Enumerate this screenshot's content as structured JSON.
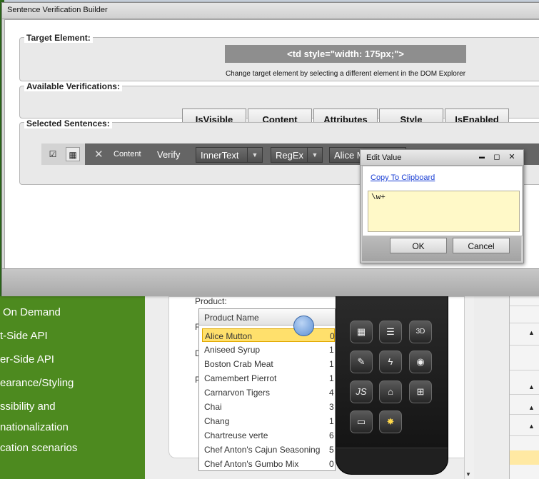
{
  "background": {
    "nav_items": [
      "On Demand",
      "t-Side API",
      "er-Side API",
      "earance/Styling",
      "ssibility and",
      "nationalization",
      "cation scenarios"
    ],
    "card_labels": {
      "product": "Product:",
      "r": "R",
      "d": "D",
      "p": "P"
    },
    "product_list": {
      "header": "Product Name",
      "rows": [
        {
          "name": "Alice Mutton",
          "value": "0",
          "selected": true
        },
        {
          "name": "Aniseed Syrup",
          "value": "1"
        },
        {
          "name": "Boston Crab Meat",
          "value": "1"
        },
        {
          "name": "Camembert Pierrot",
          "value": "1"
        },
        {
          "name": "Carnarvon Tigers",
          "value": "4"
        },
        {
          "name": "Chai",
          "value": "3"
        },
        {
          "name": "Chang",
          "value": "1"
        },
        {
          "name": "Chartreuse verte",
          "value": "6"
        },
        {
          "name": "Chef Anton's Cajun Seasoning",
          "value": "5"
        },
        {
          "name": "Chef Anton's Gumbo Mix",
          "value": "0"
        }
      ]
    },
    "toolbox_icons": [
      "grid-icon",
      "list-icon",
      "3d-box-icon",
      "edit-doc-icon",
      "lightning-icon",
      "cursor-globe-icon",
      "js-icon",
      "mouse-icon",
      "layout-icon",
      "window-icon",
      "gear-burst-icon"
    ],
    "toolbox_glyphs": {
      "js": "JS",
      "threed": "3D"
    },
    "sort_arrow": "▲"
  },
  "dialog": {
    "title": "Sentence Verification Builder",
    "target_section": {
      "label": "Target Element:",
      "element": "<td style=\"width: 175px;\">",
      "hint": "Change target element by selecting a different element in the DOM Explorer"
    },
    "verifications_section": {
      "label": "Available Verifications:",
      "buttons": [
        "IsVisible",
        "Content",
        "Attributes",
        "Style",
        "IsEnabled"
      ]
    },
    "sentences_section": {
      "label": "Selected Sentences:",
      "sentence": {
        "type": "Content",
        "verb": "Verify",
        "property": "InnerText",
        "operator": "RegEx",
        "value": "Alice Mutton"
      }
    }
  },
  "edit_value": {
    "title": "Edit Value",
    "copy_link": "Copy To Clipboard",
    "value": "\\w+",
    "ok_label": "OK",
    "cancel_label": "Cancel",
    "min_glyph": "▬",
    "max_glyph": "◻",
    "close_glyph": "✕"
  },
  "icons": {
    "verify_check": "☑",
    "tree": "▦",
    "remove": "✕",
    "dropdown_arrow": "▼"
  }
}
